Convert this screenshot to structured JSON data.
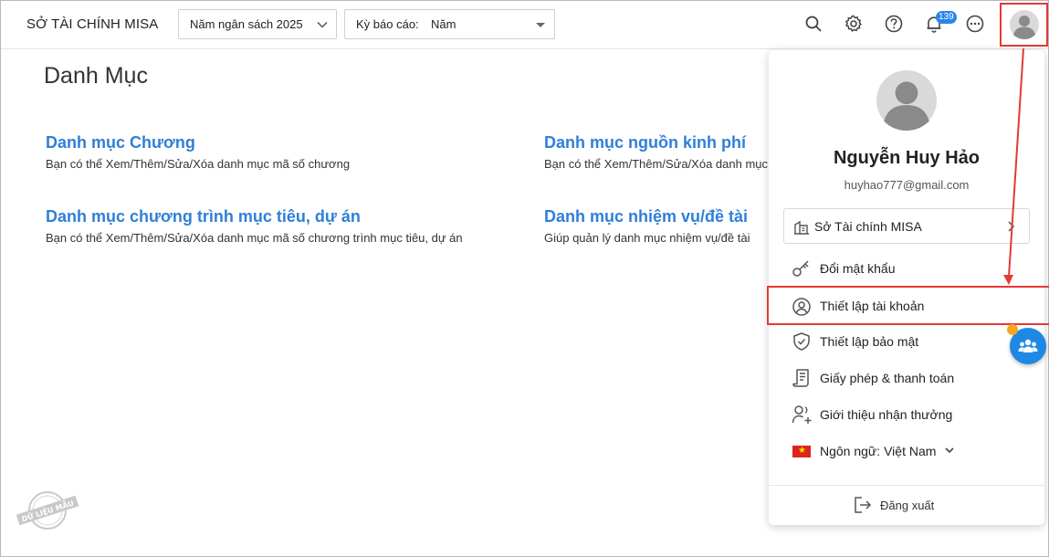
{
  "header": {
    "app_title": "SỞ TÀI CHÍNH MISA",
    "budget_year": "Năm ngân sách 2025",
    "period_label": "Kỳ báo cáo:",
    "period_value": "Năm",
    "notification_count": "139"
  },
  "main": {
    "title": "Danh Mục",
    "categories": [
      {
        "title": "Danh mục Chương",
        "desc": "Bạn có thể Xem/Thêm/Sửa/Xóa danh mục mã số chương"
      },
      {
        "title": "Danh mục nguồn kinh phí",
        "desc": "Bạn có thể Xem/Thêm/Sửa/Xóa danh mục"
      },
      {
        "title": "Danh mục chương trình mục tiêu, dự án",
        "desc": "Bạn có thể Xem/Thêm/Sửa/Xóa danh mục mã số chương trình mục tiêu, dự án"
      },
      {
        "title": "Danh mục nhiệm vụ/đề tài",
        "desc": "Giúp quản lý danh mục nhiệm vụ/đề tài"
      }
    ],
    "stamp_text": "DỮ LIỆU MẪU"
  },
  "user_menu": {
    "name": "Nguyễn Huy Hảo",
    "email": "huyhao777@gmail.com",
    "organization": "Sở Tài chính MISA",
    "items": [
      {
        "label": "Đổi mật khẩu",
        "icon": "key-icon"
      },
      {
        "label": "Thiết lập tài khoản",
        "icon": "user-circle-icon"
      },
      {
        "label": "Thiết lập bảo mật",
        "icon": "shield-check-icon"
      },
      {
        "label": "Giấy phép & thanh toán",
        "icon": "license-icon"
      },
      {
        "label": "Giới thiệu nhận thưởng",
        "icon": "user-plus-icon"
      }
    ],
    "language": "Ngôn ngữ: Việt Nam",
    "logout": "Đăng xuất"
  },
  "colors": {
    "accent": "#2f7fd8",
    "annotation": "#e53935",
    "badge": "#2a86e8",
    "fab": "#1e88e5"
  }
}
